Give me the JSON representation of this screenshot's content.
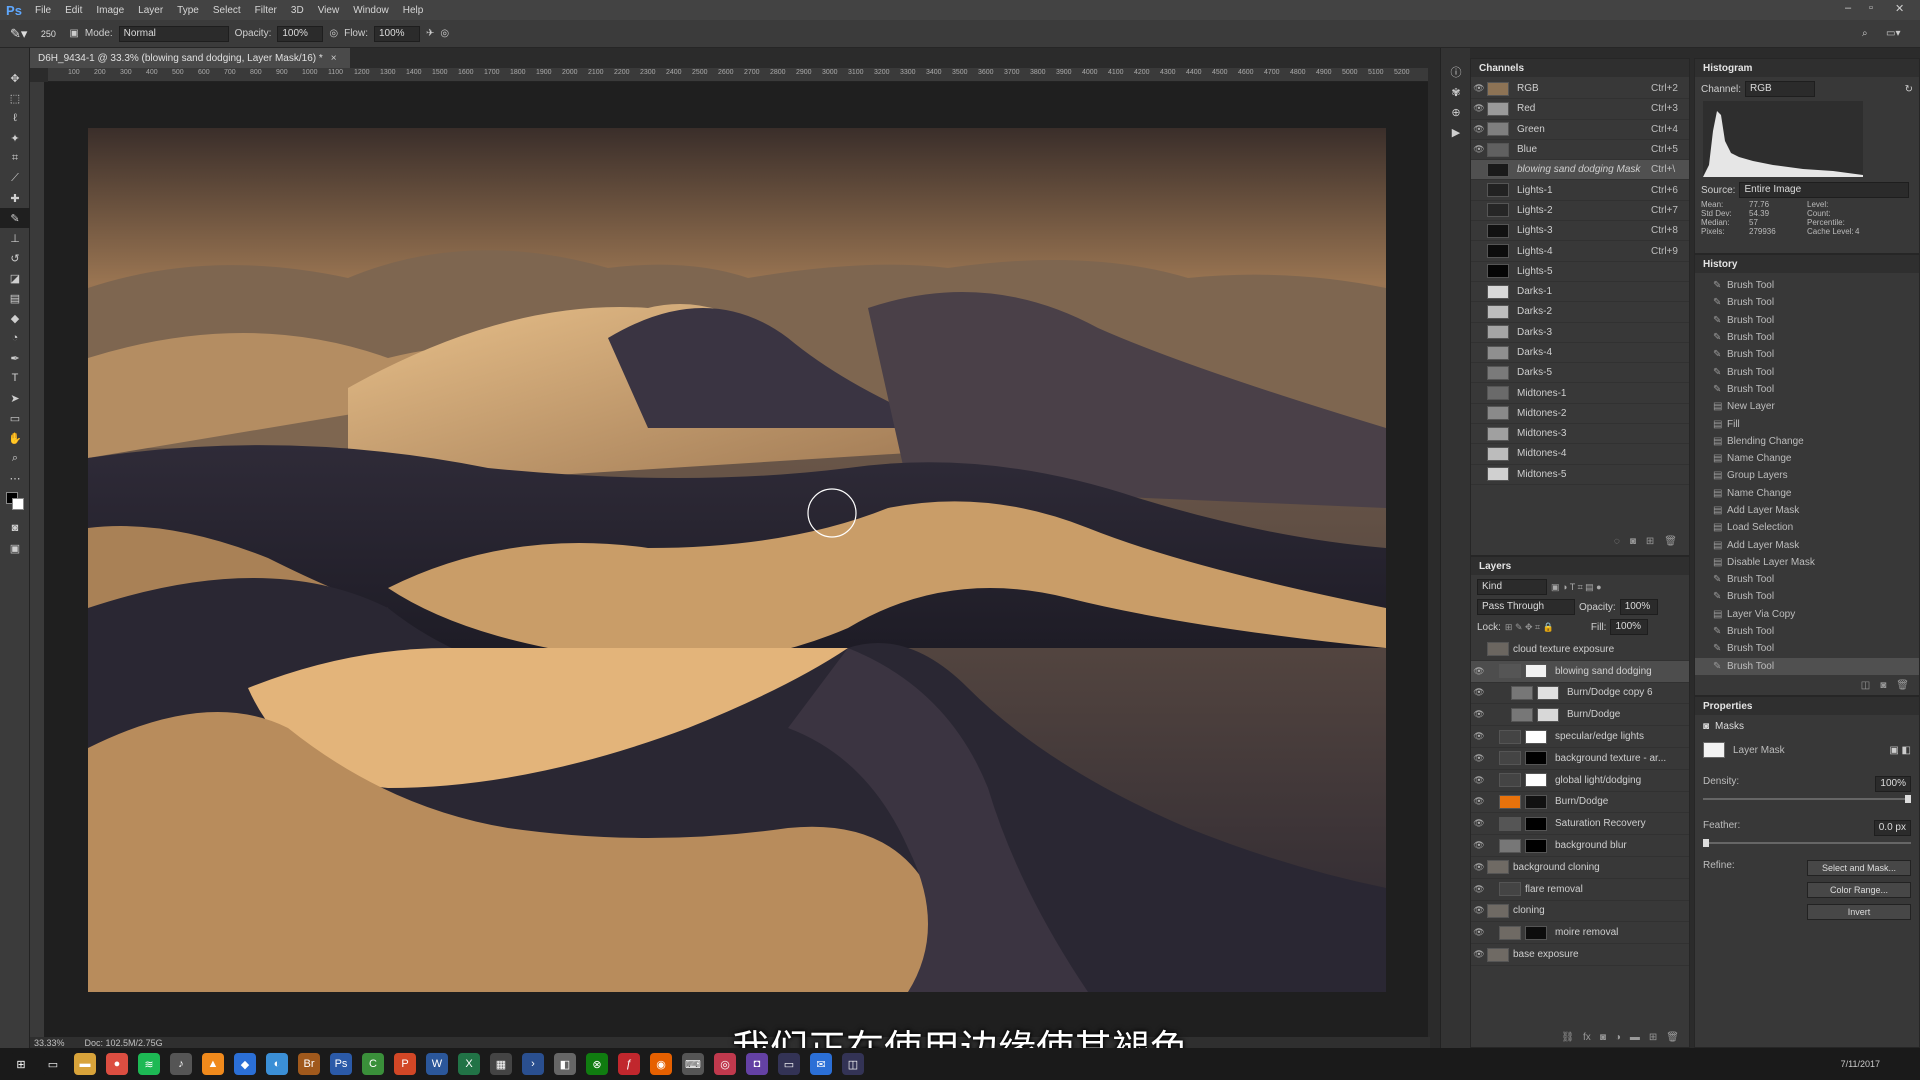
{
  "app": {
    "logo": "Ps"
  },
  "menubar": [
    "File",
    "Edit",
    "Image",
    "Layer",
    "Type",
    "Select",
    "Filter",
    "3D",
    "View",
    "Window",
    "Help"
  ],
  "window_controls": [
    "–",
    "▫",
    "✕"
  ],
  "options": {
    "brush_size": "250",
    "mode_label": "Mode:",
    "mode_value": "Normal",
    "opacity_label": "Opacity:",
    "opacity_value": "100%",
    "flow_label": "Flow:",
    "flow_value": "100%"
  },
  "document": {
    "tab_title": "D6H_9434-1 @ 33.3% (blowing sand dodging, Layer Mask/16) *",
    "close": "×"
  },
  "status": {
    "zoom": "33.33%",
    "doc": "Doc: 102.5M/2.75G"
  },
  "ruler_ticks": [
    "100",
    "200",
    "300",
    "400",
    "500",
    "600",
    "700",
    "800",
    "900",
    "1000",
    "1100",
    "1200",
    "1300",
    "1400",
    "1500",
    "1600",
    "1700",
    "1800",
    "1900",
    "2000",
    "2100",
    "2200",
    "2300",
    "2400",
    "2500",
    "2600",
    "2700",
    "2800",
    "2900",
    "3000",
    "3100",
    "3200",
    "3300",
    "3400",
    "3500",
    "3600",
    "3700",
    "3800",
    "3900",
    "4000",
    "4100",
    "4200",
    "4300",
    "4400",
    "4500",
    "4600",
    "4700",
    "4800",
    "4900",
    "5000",
    "5100",
    "5200"
  ],
  "channels": {
    "title": "Channels",
    "items": [
      {
        "name": "RGB",
        "shortcut": "Ctrl+2",
        "thumb": "#8d7355",
        "visible": true
      },
      {
        "name": "Red",
        "shortcut": "Ctrl+3",
        "thumb": "#9a9a9a",
        "visible": true
      },
      {
        "name": "Green",
        "shortcut": "Ctrl+4",
        "thumb": "#7f7f7f",
        "visible": true
      },
      {
        "name": "Blue",
        "shortcut": "Ctrl+5",
        "thumb": "#606060",
        "visible": true
      },
      {
        "name": "blowing sand dodging Mask",
        "shortcut": "Ctrl+\\",
        "thumb": "#1a1a1a",
        "visible": false,
        "active": true
      },
      {
        "name": "Lights-1",
        "shortcut": "Ctrl+6",
        "thumb": "#222",
        "visible": false
      },
      {
        "name": "Lights-2",
        "shortcut": "Ctrl+7",
        "thumb": "#262626",
        "visible": false
      },
      {
        "name": "Lights-3",
        "shortcut": "Ctrl+8",
        "thumb": "#111",
        "visible": false
      },
      {
        "name": "Lights-4",
        "shortcut": "Ctrl+9",
        "thumb": "#0c0c0c",
        "visible": false
      },
      {
        "name": "Lights-5",
        "shortcut": "",
        "thumb": "#050505",
        "visible": false
      },
      {
        "name": "Darks-1",
        "shortcut": "",
        "thumb": "#d8d8d8",
        "visible": false
      },
      {
        "name": "Darks-2",
        "shortcut": "",
        "thumb": "#bdbdbd",
        "visible": false
      },
      {
        "name": "Darks-3",
        "shortcut": "",
        "thumb": "#a5a5a5",
        "visible": false
      },
      {
        "name": "Darks-4",
        "shortcut": "",
        "thumb": "#8f8f8f",
        "visible": false
      },
      {
        "name": "Darks-5",
        "shortcut": "",
        "thumb": "#7a7a7a",
        "visible": false
      },
      {
        "name": "Midtones-1",
        "shortcut": "",
        "thumb": "#6a6a6a",
        "visible": false
      },
      {
        "name": "Midtones-2",
        "shortcut": "",
        "thumb": "#8a8a8a",
        "visible": false
      },
      {
        "name": "Midtones-3",
        "shortcut": "",
        "thumb": "#a0a0a0",
        "visible": false
      },
      {
        "name": "Midtones-4",
        "shortcut": "",
        "thumb": "#bcbcbc",
        "visible": false
      },
      {
        "name": "Midtones-5",
        "shortcut": "",
        "thumb": "#d0d0d0",
        "visible": false
      }
    ]
  },
  "histogram": {
    "title": "Histogram",
    "channel_label": "Channel:",
    "channel_value": "RGB",
    "source_label": "Source:",
    "source_value": "Entire Image",
    "stats_left": [
      [
        "Mean:",
        "77.76"
      ],
      [
        "Std Dev:",
        "54.39"
      ],
      [
        "Median:",
        "57"
      ],
      [
        "Pixels:",
        "279936"
      ]
    ],
    "stats_right": [
      [
        "Level:",
        ""
      ],
      [
        "Count:",
        ""
      ],
      [
        "Percentile:",
        ""
      ],
      [
        "Cache Level:",
        "4"
      ]
    ]
  },
  "history": {
    "title": "History",
    "items": [
      {
        "label": "Brush Tool",
        "icon": "brush"
      },
      {
        "label": "Brush Tool",
        "icon": "brush"
      },
      {
        "label": "Brush Tool",
        "icon": "brush"
      },
      {
        "label": "Brush Tool",
        "icon": "brush"
      },
      {
        "label": "Brush Tool",
        "icon": "brush"
      },
      {
        "label": "Brush Tool",
        "icon": "brush"
      },
      {
        "label": "Brush Tool",
        "icon": "brush"
      },
      {
        "label": "New Layer",
        "icon": "doc"
      },
      {
        "label": "Fill",
        "icon": "doc"
      },
      {
        "label": "Blending Change",
        "icon": "doc"
      },
      {
        "label": "Name Change",
        "icon": "doc"
      },
      {
        "label": "Group Layers",
        "icon": "doc"
      },
      {
        "label": "Name Change",
        "icon": "doc"
      },
      {
        "label": "Add Layer Mask",
        "icon": "doc"
      },
      {
        "label": "Load Selection",
        "icon": "doc"
      },
      {
        "label": "Add Layer Mask",
        "icon": "doc"
      },
      {
        "label": "Disable Layer Mask",
        "icon": "doc"
      },
      {
        "label": "Brush Tool",
        "icon": "brush"
      },
      {
        "label": "Brush Tool",
        "icon": "brush"
      },
      {
        "label": "Layer Via Copy",
        "icon": "doc"
      },
      {
        "label": "Brush Tool",
        "icon": "brush"
      },
      {
        "label": "Brush Tool",
        "icon": "brush"
      },
      {
        "label": "Brush Tool",
        "icon": "brush",
        "active": true
      }
    ]
  },
  "layers": {
    "title": "Layers",
    "filter": "Kind",
    "blend": "Pass Through",
    "opacity_label": "Opacity:",
    "opacity_value": "100%",
    "lock_label": "Lock:",
    "fill_label": "Fill:",
    "fill_value": "100%",
    "items": [
      {
        "name": "cloud texture exposure",
        "indent": 0,
        "visible": false,
        "thumb": "#6b6660",
        "mask": ""
      },
      {
        "name": "blowing sand dodging",
        "indent": 1,
        "visible": true,
        "thumb": "#555",
        "mask": "#f2f2f2",
        "active": true
      },
      {
        "name": "Burn/Dodge copy 6",
        "indent": 2,
        "visible": true,
        "thumb": "#777",
        "mask": "#e0e0e0"
      },
      {
        "name": "Burn/Dodge",
        "indent": 2,
        "visible": true,
        "thumb": "#777",
        "mask": "#d8d8d8"
      },
      {
        "name": "specular/edge lights",
        "indent": 1,
        "visible": true,
        "thumb": "#444",
        "mask": "#ffffff"
      },
      {
        "name": "background texture - ar...",
        "indent": 1,
        "visible": true,
        "thumb": "#444",
        "mask": "#000000"
      },
      {
        "name": "global light/dodging",
        "indent": 1,
        "visible": true,
        "thumb": "#444",
        "mask": "#ffffff"
      },
      {
        "name": "Burn/Dodge",
        "indent": 1,
        "visible": true,
        "thumb": "#e8720c",
        "mask": "#111111"
      },
      {
        "name": "Saturation Recovery",
        "indent": 1,
        "visible": true,
        "thumb": "#555",
        "mask": "#000000"
      },
      {
        "name": "background blur",
        "indent": 1,
        "visible": true,
        "thumb": "#777",
        "mask": "#000000"
      },
      {
        "name": "background cloning",
        "indent": 0,
        "visible": true,
        "thumb": "#6f6a64",
        "mask": ""
      },
      {
        "name": "flare removal",
        "indent": 1,
        "visible": true,
        "thumb": "#444",
        "mask": ""
      },
      {
        "name": "cloning",
        "indent": 0,
        "visible": true,
        "thumb": "#6f6a64",
        "mask": ""
      },
      {
        "name": "moire removal",
        "indent": 1,
        "visible": true,
        "thumb": "#6f6a64",
        "mask": "#0d0d0d"
      },
      {
        "name": "base exposure",
        "indent": 0,
        "visible": true,
        "thumb": "#6f6a64",
        "mask": ""
      }
    ]
  },
  "properties": {
    "title": "Properties",
    "masks_label": "Masks",
    "layer_mask_label": "Layer Mask",
    "density_label": "Density:",
    "density_value": "100%",
    "feather_label": "Feather:",
    "feather_value": "0.0 px",
    "refine_label": "Refine:",
    "select_mask": "Select and Mask...",
    "color_range": "Color Range...",
    "invert": "Invert"
  },
  "subtitle": "我们正在使用边缘使其褪色",
  "taskbar": {
    "date": "7/11/2017",
    "icons": [
      {
        "name": "windows-start-icon",
        "color": "#1a1a1a",
        "glyph": "⊞"
      },
      {
        "name": "task-view-icon",
        "color": "#1a1a1a",
        "glyph": "▭"
      },
      {
        "name": "file-explorer-icon",
        "color": "#d8a33a",
        "glyph": "▬"
      },
      {
        "name": "chrome-icon",
        "color": "#dc4e41",
        "glyph": "●"
      },
      {
        "name": "spotify-icon",
        "color": "#1db954",
        "glyph": "≋"
      },
      {
        "name": "music-app-icon",
        "color": "#555",
        "glyph": "♪"
      },
      {
        "name": "vlc-icon",
        "color": "#f08a1c",
        "glyph": "▲"
      },
      {
        "name": "dropbox-icon",
        "color": "#2b6fd6",
        "glyph": "◆"
      },
      {
        "name": "browser-icon",
        "color": "#3b8fd6",
        "glyph": "◐"
      },
      {
        "name": "bridge-icon",
        "color": "#a0591c",
        "glyph": "Br"
      },
      {
        "name": "photoshop-icon",
        "color": "#2b5aa8",
        "glyph": "Ps"
      },
      {
        "name": "camtasia-icon",
        "color": "#3a8f3a",
        "glyph": "C"
      },
      {
        "name": "powerpoint-icon",
        "color": "#d24726",
        "glyph": "P"
      },
      {
        "name": "word-icon",
        "color": "#2b579a",
        "glyph": "W"
      },
      {
        "name": "excel-icon",
        "color": "#217346",
        "glyph": "X"
      },
      {
        "name": "calculator-icon",
        "color": "#444",
        "glyph": "▦"
      },
      {
        "name": "powershell-icon",
        "color": "#2a4f8f",
        "glyph": "›"
      },
      {
        "name": "app-icon",
        "color": "#666",
        "glyph": "◧"
      },
      {
        "name": "xbox-icon",
        "color": "#107c10",
        "glyph": "⊗"
      },
      {
        "name": "flash-icon",
        "color": "#c1272d",
        "glyph": "ƒ"
      },
      {
        "name": "firefox-icon",
        "color": "#e66000",
        "glyph": "◉"
      },
      {
        "name": "keyboard-icon",
        "color": "#555",
        "glyph": "⌨"
      },
      {
        "name": "media-icon",
        "color": "#c0394d",
        "glyph": "◎"
      },
      {
        "name": "twitch-icon",
        "color": "#6441a4",
        "glyph": "◘"
      },
      {
        "name": "monitor-icon",
        "color": "#335",
        "glyph": "▭"
      },
      {
        "name": "mail-icon",
        "color": "#2b6fd6",
        "glyph": "✉"
      },
      {
        "name": "store-icon",
        "color": "#335",
        "glyph": "◫"
      }
    ]
  }
}
